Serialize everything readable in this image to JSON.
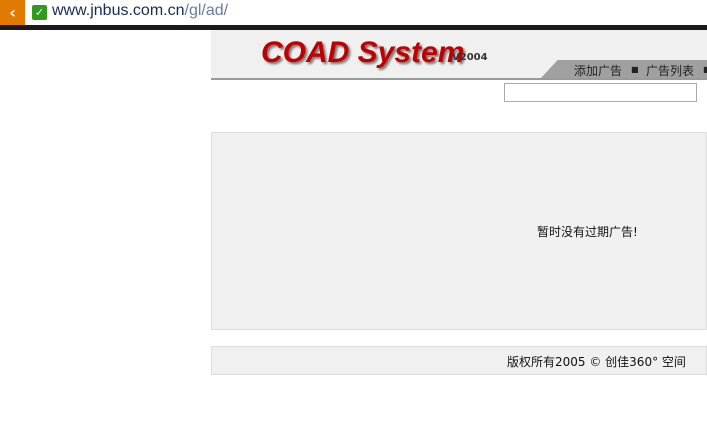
{
  "browser": {
    "url_host": "www.jnbus.com.cn",
    "url_path": "/gl/ad/",
    "back_icon": "chevron-left-icon",
    "secure_icon": "check-icon"
  },
  "header": {
    "logo": "COAD System",
    "version": "V2004",
    "nav": [
      "添加广告",
      "广告列表"
    ]
  },
  "main": {
    "message": "暂时没有过期广告!"
  },
  "footer": {
    "copyright": "版权所有2005 © 创佳360° 空间"
  }
}
